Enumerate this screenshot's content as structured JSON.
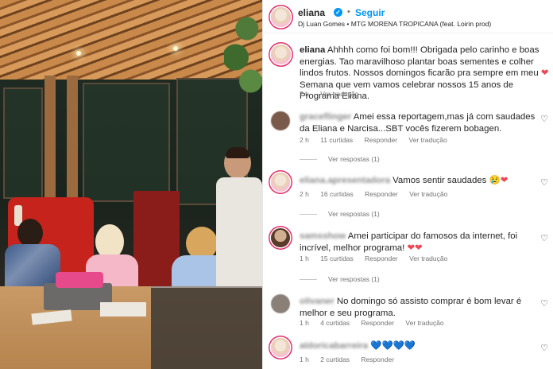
{
  "post": {
    "username": "eliana",
    "verified_mark": "✓",
    "separator": "•",
    "follow_label": "Seguir",
    "audio": "Dj Luan Gomes • MTG MORENA TROPICANA (feat. Loirin prod)"
  },
  "caption": {
    "username": "eliana",
    "text": "Ahhhh como foi bom!!! Obrigada pelo carinho e boas energias. Tao maravilhoso plantar boas sementes e colher lindos frutos. Nossos domingos ficarão pra sempre em meu",
    "emoji": "❤",
    "text_after": "Semana que vem vamos celebrar nossos 15 anos de Programa Eliana.",
    "time": "2 h",
    "translate": "Ver tradução"
  },
  "comments": [
    {
      "username": "graceflinger",
      "text": "Amei essa reportagem,mas já com saudades da Eliana e Narcisa...SBT vocês fizerem bobagen.",
      "time": "2 h",
      "likes": "11 curtidas",
      "reply": "Responder",
      "translate": "Ver tradução",
      "replies": "Ver respostas (1)"
    },
    {
      "username": "eliana.apresentadora",
      "text": "Vamos sentir saudades",
      "emoji": "😢❤",
      "time": "2 h",
      "likes": "16 curtidas",
      "reply": "Responder",
      "translate": "Ver tradução",
      "replies": "Ver respostas (1)"
    },
    {
      "username": "samsshow",
      "text": "Amei participar do famosos da internet, foi incrível, melhor programa!",
      "emoji": "❤❤",
      "time": "1 h",
      "likes": "15 curtidas",
      "reply": "Responder",
      "translate": "Ver tradução",
      "replies": "Ver respostas (1)"
    },
    {
      "username": "olivaner",
      "text": "No domingo só assisto comprar é bom levar é melhor e seu programa.",
      "time": "1 h",
      "likes": "4 curtidas",
      "reply": "Responder",
      "translate": "Ver tradução"
    },
    {
      "username": "aldoricabarreira",
      "emoji": "💙💙💙💙",
      "time": "1 h",
      "likes": "2 curtidas",
      "reply": "Responder"
    }
  ],
  "icons": {
    "like": "heart-outline-icon",
    "avatar": "profile-avatar"
  },
  "colors": {
    "link_blue": "#0095f6",
    "muted": "#737373",
    "text": "#262626"
  }
}
